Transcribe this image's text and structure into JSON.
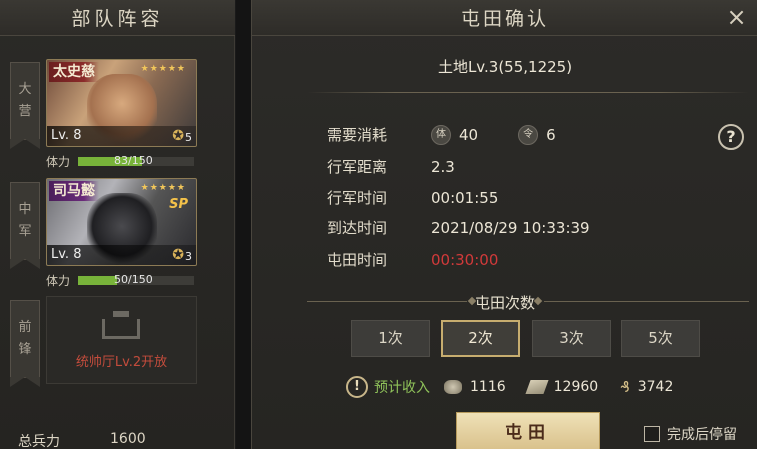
{
  "left_panel": {
    "title": "部队阵容",
    "slots": [
      {
        "tag": [
          "大",
          "营"
        ]
      },
      {
        "tag": [
          "中",
          "军"
        ]
      },
      {
        "tag": [
          "前",
          "锋"
        ]
      }
    ],
    "heroes": [
      {
        "name": "太史慈",
        "stars": "★★★★★",
        "level": "Lv. 8",
        "badge_count": "5",
        "stamina_label": "体力",
        "stamina_text": "83/150",
        "stamina_fraction": 0.553,
        "sp": ""
      },
      {
        "name": "司马懿",
        "stars": "★★★★★",
        "level": "Lv. 8",
        "badge_count": "3",
        "stamina_label": "体力",
        "stamina_text": "50/150",
        "stamina_fraction": 0.333,
        "sp": "SP"
      }
    ],
    "locked_slot_text": "统帅厅Lv.2开放",
    "total_troops_label": "总兵力",
    "total_troops_value": "1600"
  },
  "dialog": {
    "title": "屯田确认",
    "close_icon": "×",
    "land_title": "土地Lv.3(55,1225)",
    "cost_label": "需要消耗",
    "cost_stamina_icon": "体",
    "cost_stamina": "40",
    "cost_order_icon": "令",
    "cost_order": "6",
    "help_icon": "?",
    "distance_label": "行军距离",
    "distance_value": "2.3",
    "march_time_label": "行军时间",
    "march_time_value": "00:01:55",
    "arrival_label": "到达时间",
    "arrival_value": "2021/08/29 10:33:39",
    "farm_time_label": "屯田时间",
    "farm_time_value": "00:30:00",
    "count_section_title": "屯田次数",
    "count_options": [
      "1次",
      "2次",
      "3次",
      "5次"
    ],
    "selected_count": "2次",
    "income_icon": "!",
    "income_label": "预计收入",
    "income": {
      "copper": "1116",
      "wood": "12960",
      "grain": "3742"
    },
    "grain_icon": "₰",
    "confirm_button": "屯田",
    "stay_after_label": "完成后停留"
  }
}
